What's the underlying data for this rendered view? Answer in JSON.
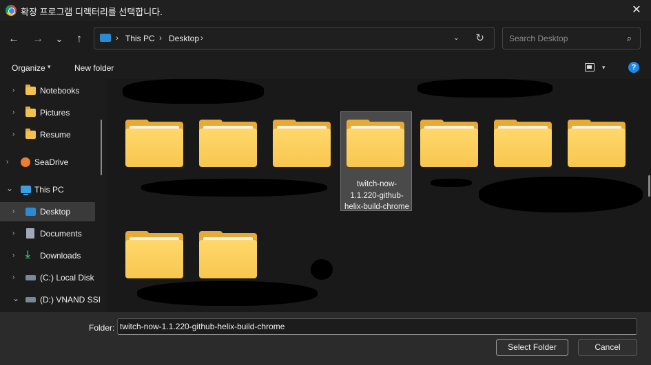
{
  "titlebar": {
    "title": "확장 프로그램 디렉터리를 선택합니다.",
    "app_icon": "chrome-icon",
    "close": "✕"
  },
  "nav": {
    "back": "←",
    "forward": "→",
    "recent": "⌄",
    "up": "↑",
    "breadcrumb": [
      "This PC",
      "Desktop"
    ],
    "sep": "›",
    "dropdown": "⌄",
    "refresh": "↻"
  },
  "search": {
    "placeholder": "Search Desktop",
    "icon": "⌕"
  },
  "toolbar": {
    "organize": "Organize",
    "organize_caret": "▾",
    "new_folder": "New folder",
    "view_caret": "▾",
    "help": "?"
  },
  "sidebar": {
    "items": [
      {
        "label": "Notebooks",
        "icon": "folder-icon",
        "chev": "›"
      },
      {
        "label": "Pictures",
        "icon": "folder-icon",
        "chev": "›"
      },
      {
        "label": "Resume",
        "icon": "folder-icon",
        "chev": "›"
      },
      {
        "label": "SeaDrive",
        "icon": "seadrive-icon",
        "chev": "›"
      },
      {
        "label": "This PC",
        "icon": "pc-icon",
        "chev": "⌄"
      },
      {
        "label": "Desktop",
        "icon": "desktop-icon",
        "chev": "›"
      },
      {
        "label": "Documents",
        "icon": "documents-icon",
        "chev": "›"
      },
      {
        "label": "Downloads",
        "icon": "downloads-icon",
        "chev": "›"
      },
      {
        "label": "(C:) Local Disk",
        "icon": "disk-icon",
        "chev": "›"
      },
      {
        "label": "(D:) VNAND SSI",
        "icon": "disk-icon",
        "chev": "⌄"
      }
    ]
  },
  "content": {
    "selected_folder_label": "twitch-now-1.1.220-github-helix-build-chrome"
  },
  "footer": {
    "folder_label": "Folder:",
    "folder_value": "twitch-now-1.1.220-github-helix-build-chrome",
    "select_button": "Select Folder",
    "cancel_button": "Cancel"
  },
  "colors": {
    "folder": "#f8c64f",
    "accent": "#1e88e5",
    "background": "#191919"
  }
}
